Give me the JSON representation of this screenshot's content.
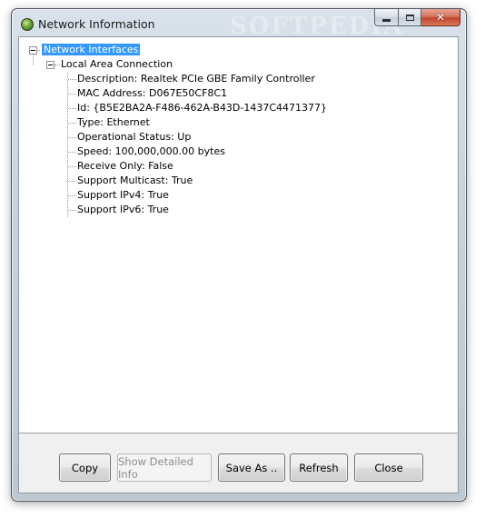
{
  "window": {
    "title": "Network Information",
    "watermark": "SOFTPEDIA"
  },
  "tree": {
    "root_label": "Network Interfaces",
    "adapter_label": "Local Area Connection",
    "properties": [
      "Description: Realtek PCIe GBE Family Controller",
      "MAC Address: D067E50CF8C1",
      "Id: {B5E2BA2A-F486-462A-B43D-1437C4471377}",
      "Type: Ethernet",
      "Operational Status: Up",
      "Speed: 100,000,000.00 bytes",
      "Receive Only: False",
      "Support Multicast: True",
      "Support IPv4: True",
      "Support IPv6: True"
    ]
  },
  "buttons": {
    "copy": "Copy",
    "show_detailed_info": "Show Detailed Info",
    "save_as": "Save As ..",
    "refresh": "Refresh",
    "close": "Close"
  },
  "icons": {
    "app": "network-globe-icon",
    "minimize": "minimize-icon",
    "maximize": "maximize-icon",
    "close": "close-icon"
  }
}
